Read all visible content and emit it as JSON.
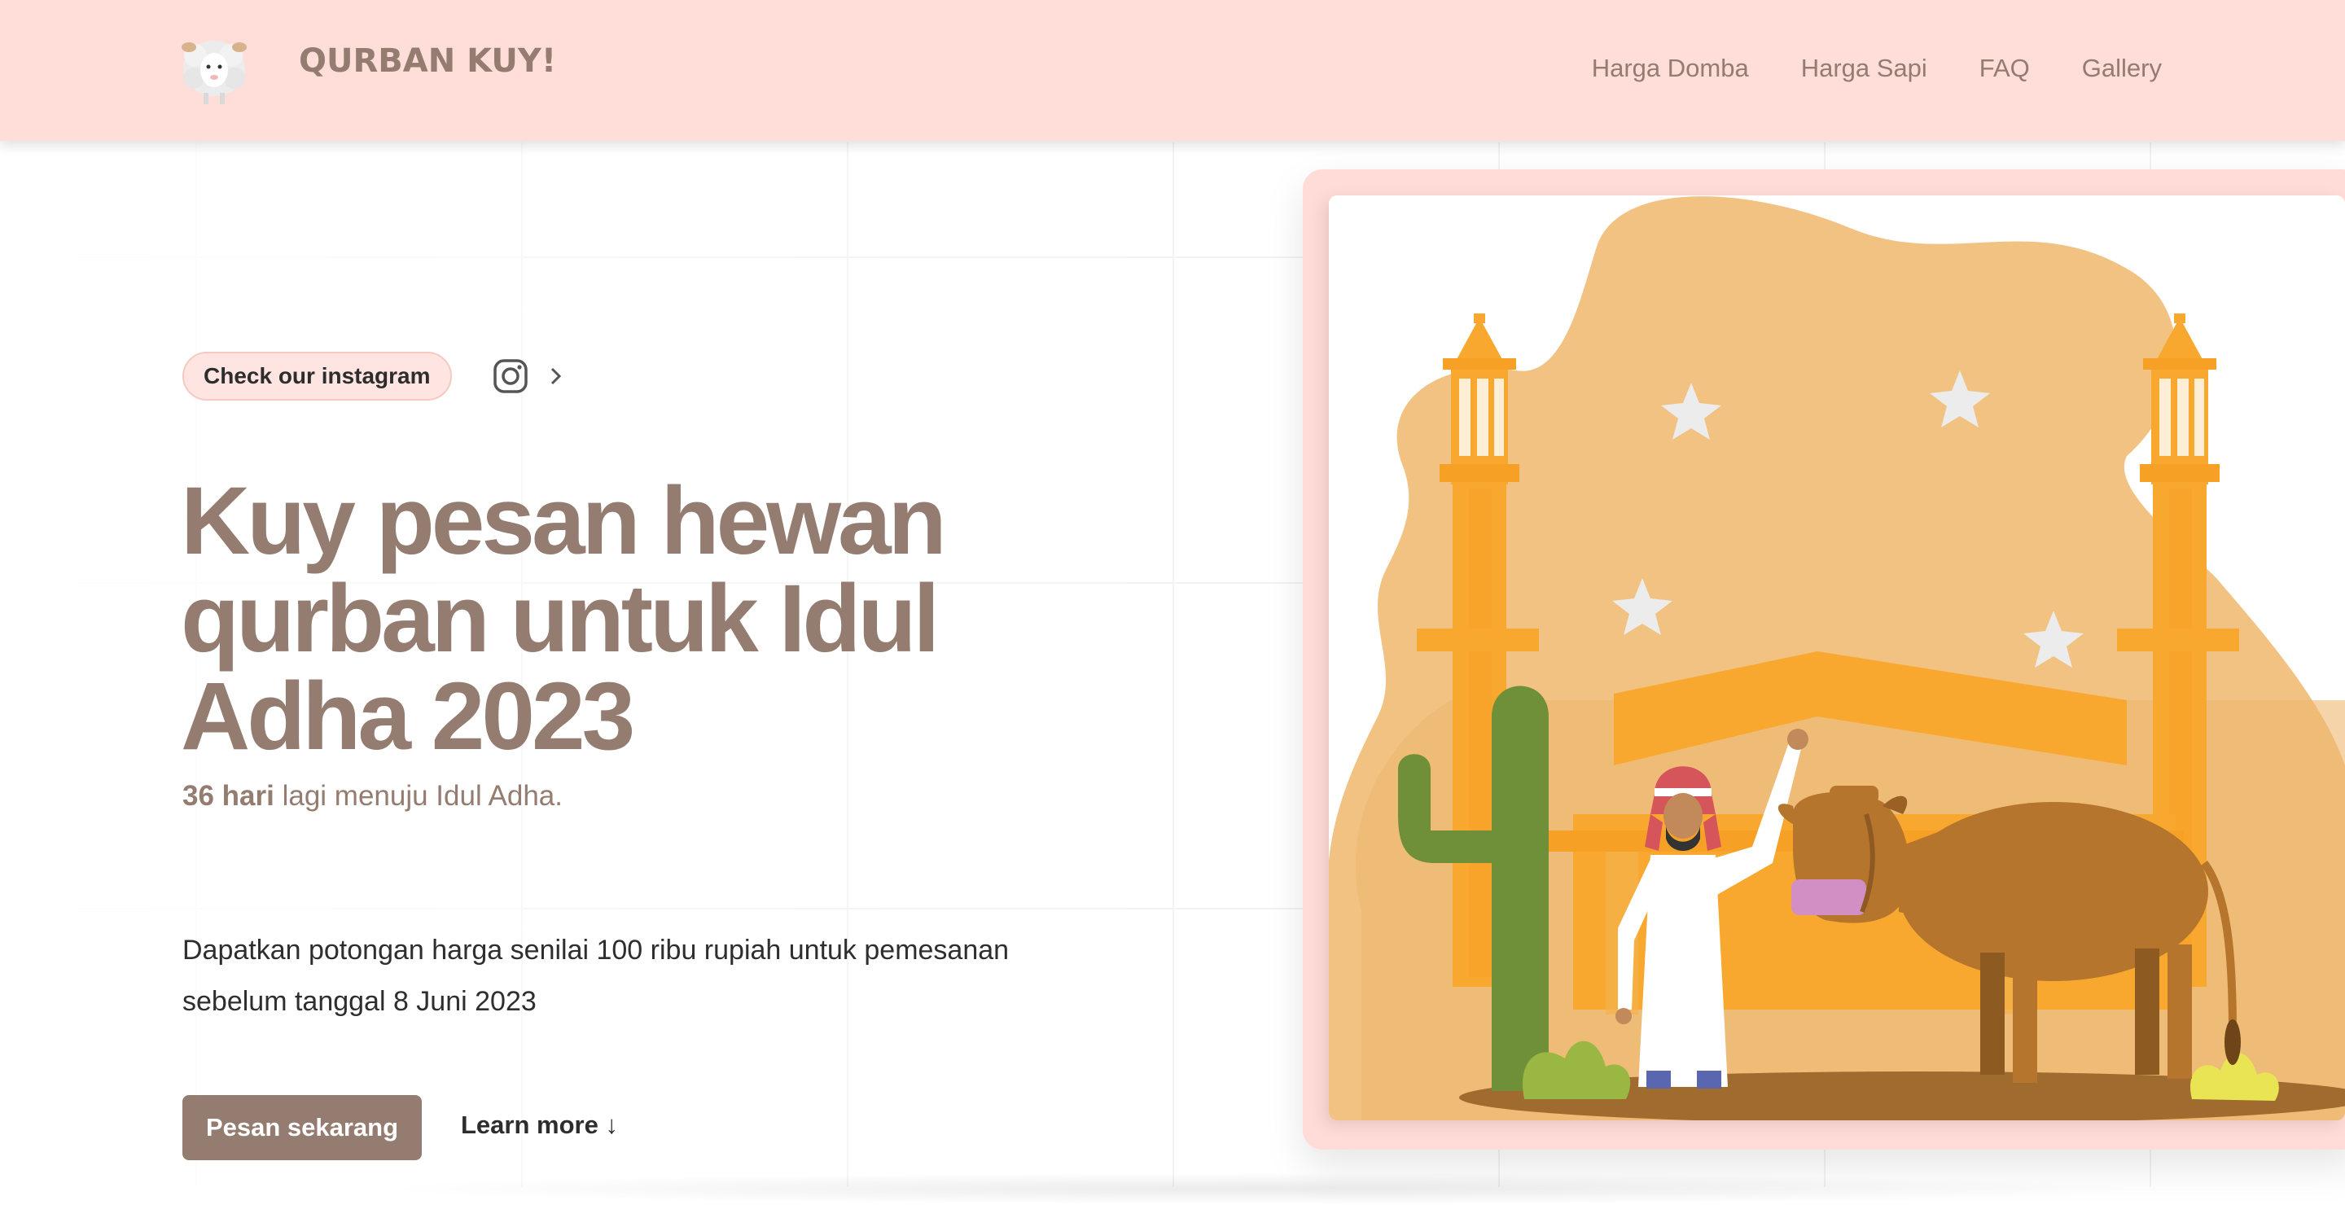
{
  "header": {
    "brand": "QURBAN KUY!",
    "logo": "sheep-icon",
    "nav": [
      {
        "label": "Harga Domba"
      },
      {
        "label": "Harga Sapi"
      },
      {
        "label": "FAQ"
      },
      {
        "label": "Gallery"
      }
    ]
  },
  "hero": {
    "badge": "Check our instagram",
    "badge_icons": [
      "instagram-icon",
      "chevron-right-icon"
    ],
    "headline": "Kuy pesan hewan qurban untuk Idul Adha 2023",
    "countdown_strong": "36 hari",
    "countdown_rest": " lagi menuju Idul Adha.",
    "description": "Dapatkan potongan harga senilai 100 ribu rupiah untuk pemesanan sebelum tanggal 8 Juni 2023",
    "primary_button": "Pesan sekarang",
    "secondary_link": "Learn more ↓"
  },
  "illustration": {
    "name": "mosque-cow-illustration",
    "colors": {
      "brand": "#947c70",
      "header_bg": "#ffddd9",
      "blob": "#f1c282",
      "mosque": "#f9a82f",
      "cow": "#b5752c",
      "cactus": "#6f9038"
    }
  }
}
